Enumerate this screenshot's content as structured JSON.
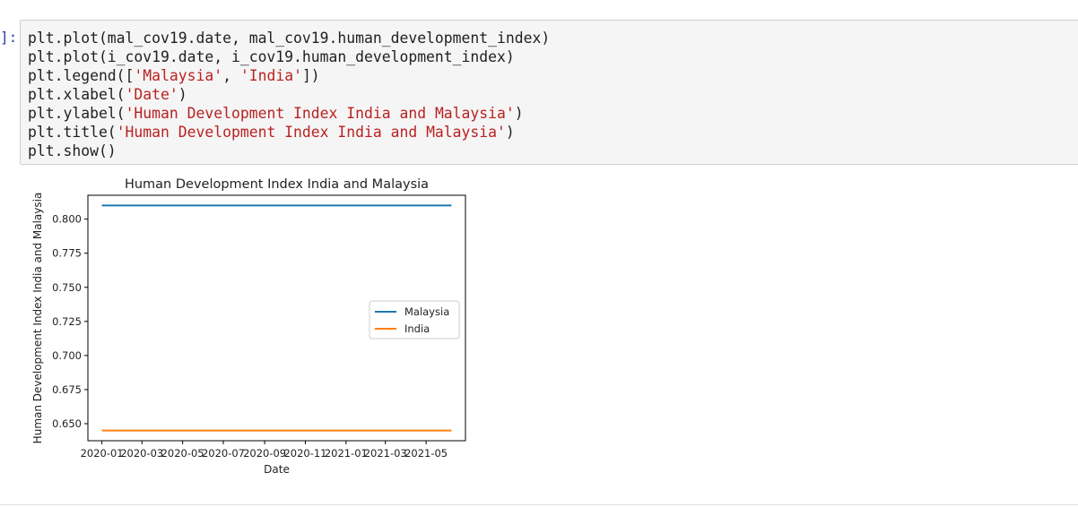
{
  "prompt": {
    "label": "]:"
  },
  "cell": {
    "lines": [
      {
        "segments": [
          {
            "text": "plt.plot(mal_cov19.date, mal_cov19.human_development_index)",
            "kind": "code"
          }
        ]
      },
      {
        "segments": [
          {
            "text": "plt.plot(i_cov19.date, i_cov19.human_development_index)",
            "kind": "code"
          }
        ]
      },
      {
        "segments": [
          {
            "text": "plt.legend([",
            "kind": "code"
          },
          {
            "text": "'Malaysia'",
            "kind": "str"
          },
          {
            "text": ", ",
            "kind": "code"
          },
          {
            "text": "'India'",
            "kind": "str"
          },
          {
            "text": "])",
            "kind": "code"
          }
        ]
      },
      {
        "segments": [
          {
            "text": "plt.xlabel(",
            "kind": "code"
          },
          {
            "text": "'Date'",
            "kind": "str"
          },
          {
            "text": ")",
            "kind": "code"
          }
        ]
      },
      {
        "segments": [
          {
            "text": "plt.ylabel(",
            "kind": "code"
          },
          {
            "text": "'Human Development Index India and Malaysia'",
            "kind": "str"
          },
          {
            "text": ")",
            "kind": "code"
          }
        ]
      },
      {
        "segments": [
          {
            "text": "plt.title(",
            "kind": "code"
          },
          {
            "text": "'Human Development Index India and Malaysia'",
            "kind": "str"
          },
          {
            "text": ")",
            "kind": "code"
          }
        ]
      },
      {
        "segments": [
          {
            "text": "plt.show()",
            "kind": "code"
          }
        ]
      }
    ]
  },
  "chart_data": {
    "type": "line",
    "title": "Human Development Index India and Malaysia",
    "xlabel": "Date",
    "ylabel": "Human Development Index India and Malaysia",
    "x_ticks": [
      "2020-01",
      "2020-03",
      "2020-05",
      "2020-07",
      "2020-09",
      "2020-11",
      "2021-01",
      "2021-03",
      "2021-05"
    ],
    "y_ticks": [
      0.65,
      0.675,
      0.7,
      0.725,
      0.75,
      0.775,
      0.8
    ],
    "y_tick_labels": [
      "0.650",
      "0.675",
      "0.700",
      "0.725",
      "0.750",
      "0.775",
      "0.800"
    ],
    "xlim": [
      "2019-12-11",
      "2021-06-29"
    ],
    "ylim": [
      0.6375,
      0.8175
    ],
    "x_range": [
      "2020-01-01",
      "2021-06-08"
    ],
    "series": [
      {
        "name": "Malaysia",
        "color": "#1f77b4",
        "x": [
          "2020-01-01",
          "2021-06-08"
        ],
        "values": [
          0.81,
          0.81
        ]
      },
      {
        "name": "India",
        "color": "#ff7f0e",
        "x": [
          "2020-01-01",
          "2021-06-08"
        ],
        "values": [
          0.645,
          0.645
        ]
      }
    ],
    "legend_position": "center right",
    "grid": false
  }
}
